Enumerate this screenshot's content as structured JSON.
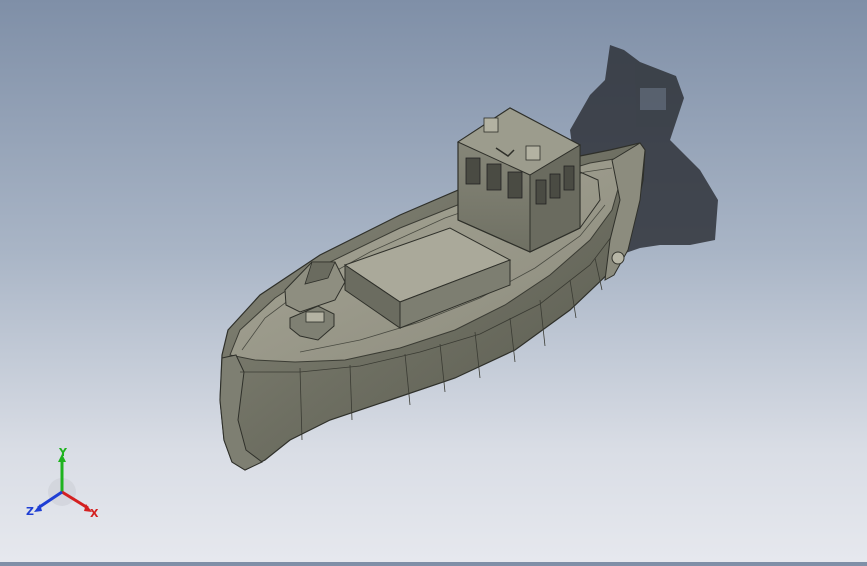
{
  "viewport": {
    "background_top": "#7f8fa7",
    "background_bottom": "#e6e8ee",
    "model": "boat-model",
    "shadow_color": "#2f3339"
  },
  "triad": {
    "x_label": "X",
    "y_label": "Y",
    "z_label": "Z",
    "x_color": "#d42020",
    "y_color": "#1fb31f",
    "z_color": "#1f3fd4"
  }
}
